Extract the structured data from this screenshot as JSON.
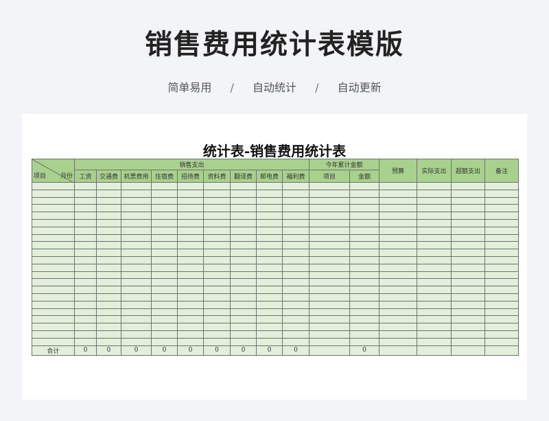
{
  "page": {
    "title": "销售费用统计表模版",
    "tags": [
      "简单易用",
      "自动统计",
      "自动更新"
    ],
    "separator": "/"
  },
  "sheet": {
    "title": "统计表-销售费用统计表",
    "corner_left": "项目",
    "corner_right": "月份",
    "group_sales": "销售支出",
    "group_ytd": "今年累计金额",
    "col_budget": "预算",
    "col_actual": "实际支出",
    "col_over": "超额支出",
    "col_note": "备注",
    "sales_columns": [
      "工资",
      "交通费",
      "机票费用",
      "住宿费",
      "招待费",
      "资料费",
      "翻译费",
      "邮电费",
      "福利费"
    ],
    "ytd_columns": [
      "项目",
      "金额"
    ],
    "body_row_count": 22,
    "total_label": "合计",
    "totals_sales": [
      "0",
      "0",
      "0",
      "0",
      "0",
      "0",
      "0",
      "0",
      "0"
    ],
    "total_ytd_item": "",
    "total_ytd_amount": "0",
    "total_budget": "",
    "total_actual": "",
    "total_over": "",
    "total_note": ""
  }
}
